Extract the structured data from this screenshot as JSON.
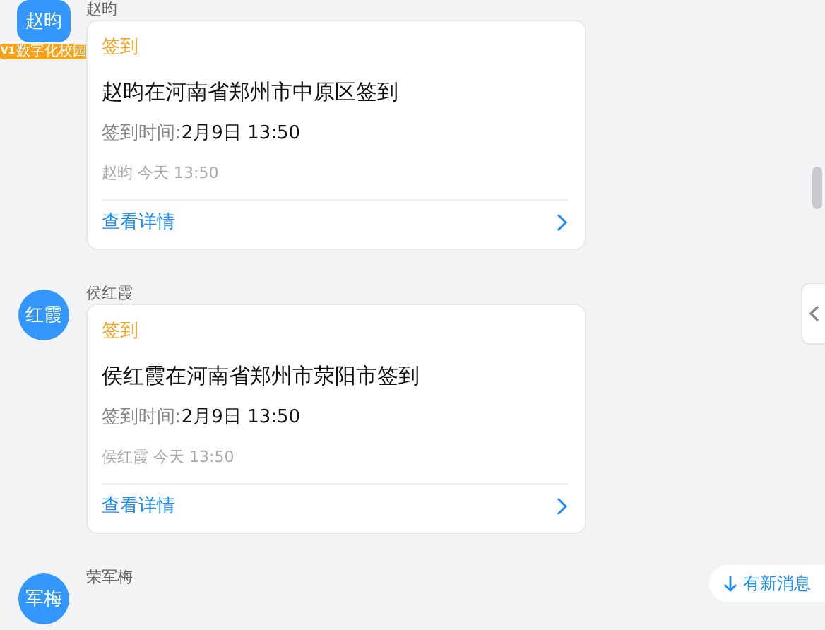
{
  "messages": [
    {
      "sender": "赵昀",
      "avatar": {
        "text": "赵昀",
        "kind": "square",
        "badge": {
          "level": "V1",
          "label": "数字化校园"
        }
      },
      "card": {
        "tag": "签到",
        "title": "赵昀在河南省郑州市中原区签到",
        "time_label": "签到时间:",
        "time_value": "2月9日 13:50",
        "meta": "赵昀 今天 13:50",
        "link": "查看详情"
      }
    },
    {
      "sender": "侯红霞",
      "avatar": {
        "text": "红霞",
        "kind": "circle"
      },
      "card": {
        "tag": "签到",
        "title": "侯红霞在河南省郑州市荥阳市签到",
        "time_label": "签到时间:",
        "time_value": "2月9日 13:50",
        "meta": "侯红霞 今天 13:50",
        "link": "查看详情"
      }
    },
    {
      "sender": "荣军梅",
      "avatar": {
        "text": "军梅",
        "kind": "circle"
      }
    }
  ],
  "new_message_pill": {
    "label": "有新消息"
  }
}
